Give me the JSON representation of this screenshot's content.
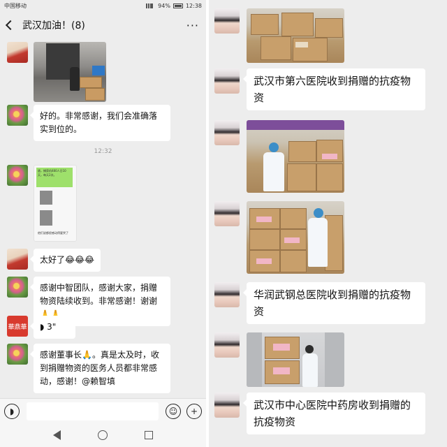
{
  "status_bar": {
    "carrier": "中国移动",
    "icons_label": "HD 4G",
    "battery": "94%",
    "time": "12:38"
  },
  "header": {
    "title": "武汉加油！(8)",
    "more": "···"
  },
  "left_messages": [
    {
      "text": "好的。非常感谢，我们会准确落实到位的。"
    },
    {
      "text": "太好了😂😂😂"
    },
    {
      "text": "感谢中智团队，感谢大家，捐赠物资陆续收到。非常感谢！谢谢🙏🙏"
    },
    {
      "text": "3\""
    },
    {
      "text": "感谢董事长🙏。真是太及时，收到捐赠物资的医务人员都非常感动，感谢！@赖智填"
    }
  ],
  "timestamp": "12:32",
  "screenshot_snippet": {
    "green_text": "盾，捕获机480人日10天，每天2次。",
    "caption": "他们说都很感动得要哭了"
  },
  "logo_text": "華鼎華",
  "right_messages": [
    {
      "text": "武汉市第六医院收到捐赠的抗疫物资"
    },
    {
      "text": "华润武钢总医院收到捐赠的抗疫物资"
    },
    {
      "text": "武汉市中心医院中药房收到捐赠的抗疫物资"
    }
  ],
  "navbar": {
    "back_icon": "triangle-back",
    "home_icon": "circle-home",
    "recent_icon": "square-recent"
  },
  "colors": {
    "chat_bg": "#ededed",
    "bubble": "#ffffff",
    "voice_accent": "#111111"
  }
}
